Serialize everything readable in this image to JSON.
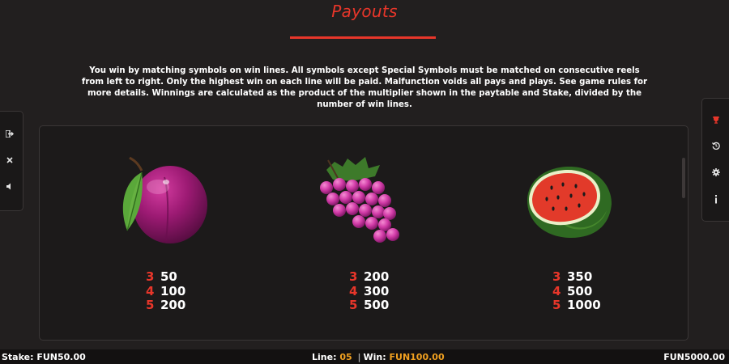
{
  "header": {
    "title": "Payouts",
    "description": "You win by matching symbols on win lines. All symbols except Special Symbols must be matched on consecutive reels from left to right. Only the highest win on each line will be paid. Malfunction voids all pays and plays. See game rules for more details. Winnings are calculated as the product of the multiplier shown in the paytable and Stake, divided by the number of win lines."
  },
  "left_sidebar": {
    "buttons": [
      {
        "icon": "exit-icon",
        "glyph": "⇥"
      },
      {
        "icon": "close-icon",
        "glyph": "✕"
      },
      {
        "icon": "sound-icon",
        "glyph": "◀"
      }
    ]
  },
  "right_sidebar": {
    "buttons": [
      {
        "icon": "trophy-icon",
        "glyph": "🏆",
        "active": true
      },
      {
        "icon": "history-icon",
        "glyph": "↺"
      },
      {
        "icon": "settings-gear-icon",
        "glyph": "⚙"
      },
      {
        "icon": "info-icon",
        "glyph": "i"
      }
    ]
  },
  "paytable": {
    "symbols": [
      {
        "name": "plum",
        "pays": [
          {
            "count": "3",
            "value": "50"
          },
          {
            "count": "4",
            "value": "100"
          },
          {
            "count": "5",
            "value": "200"
          }
        ]
      },
      {
        "name": "grapes",
        "pays": [
          {
            "count": "3",
            "value": "200"
          },
          {
            "count": "4",
            "value": "300"
          },
          {
            "count": "5",
            "value": "500"
          }
        ]
      },
      {
        "name": "watermelon",
        "pays": [
          {
            "count": "3",
            "value": "350"
          },
          {
            "count": "4",
            "value": "500"
          },
          {
            "count": "5",
            "value": "1000"
          }
        ]
      }
    ]
  },
  "status_bar": {
    "stake_label": "Stake:",
    "stake_value": "FUN50.00",
    "line_label": "Line:",
    "line_value": "05",
    "separator": "|",
    "win_label": "Win:",
    "win_value": "FUN100.00",
    "balance": "FUN5000.00"
  },
  "colors": {
    "accent": "#e8362a",
    "background": "#221f1f",
    "highlight": "#f0a020"
  }
}
